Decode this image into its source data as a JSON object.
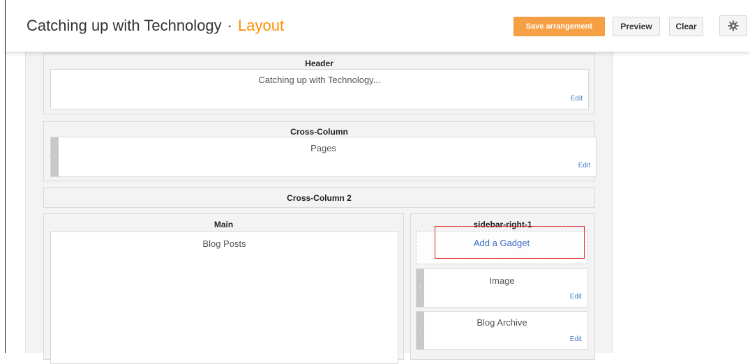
{
  "header": {
    "blog_title": "Catching up with Technology",
    "separator": "·",
    "page_name": "Layout",
    "save_label": "Save arrangement",
    "preview_label": "Preview",
    "clear_label": "Clear",
    "settings_icon": "gear-icon"
  },
  "sections": {
    "header": {
      "title": "Header",
      "widget_label": "Catching up with Technology...",
      "edit_label": "Edit"
    },
    "cross_column": {
      "title": "Cross-Column",
      "widget_label": "Pages",
      "edit_label": "Edit"
    },
    "cross_column_2": {
      "title": "Cross-Column 2"
    },
    "main": {
      "title": "Main",
      "widget_label": "Blog Posts"
    },
    "sidebar": {
      "title": "sidebar-right-1",
      "add_gadget_label": "Add a Gadget",
      "widgets": [
        {
          "label": "Image",
          "edit_label": "Edit"
        },
        {
          "label": "Blog Archive",
          "edit_label": "Edit"
        }
      ]
    }
  },
  "colors": {
    "accent": "#ff8f00",
    "save_button": "#f5a044",
    "link": "#3a69c6",
    "highlight": "#e02020"
  }
}
